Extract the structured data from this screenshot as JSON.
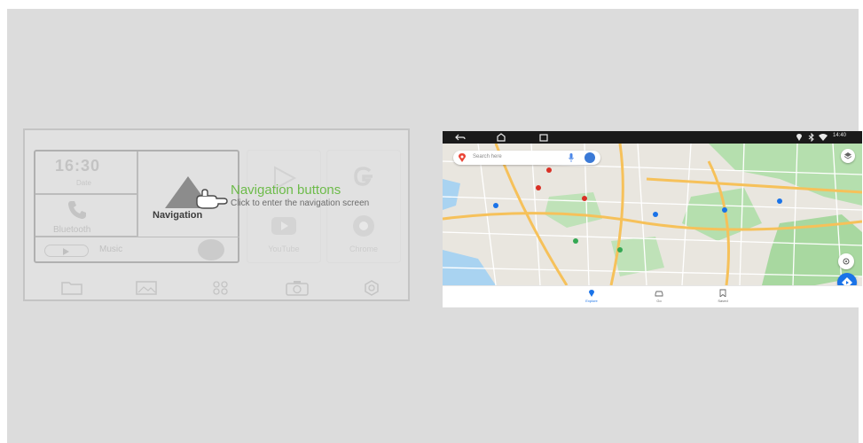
{
  "launcher": {
    "clock": {
      "time": "16:30",
      "date": "Date"
    },
    "bluetooth_label": "Bluetooth",
    "navigation_label": "Navigation",
    "music_label": "Music",
    "apps": [
      {
        "label": "",
        "icon": "play-store-icon"
      },
      {
        "label": "",
        "icon": "google-icon"
      },
      {
        "label": "YouTube",
        "icon": "youtube-icon"
      },
      {
        "label": "Chrome",
        "icon": "chrome-icon"
      }
    ],
    "dock_icons": [
      "folder-icon",
      "gallery-icon",
      "apps-grid-icon",
      "camera-icon",
      "settings-icon"
    ]
  },
  "annotation": {
    "title": "Navigation buttons",
    "subtitle": "Click to enter the navigation screen",
    "title_color": "#6dbb4a"
  },
  "map_screen": {
    "status_bar": {
      "time": "14:40"
    },
    "search_placeholder": "Search here",
    "bottom_nav": [
      {
        "label": "Explore",
        "active": true
      },
      {
        "label": "Go",
        "active": false
      },
      {
        "label": "Saved",
        "active": false
      }
    ],
    "colors": {
      "accent": "#1a73e8",
      "park": "#a8d8a0",
      "road_major": "#f6c15a"
    }
  }
}
